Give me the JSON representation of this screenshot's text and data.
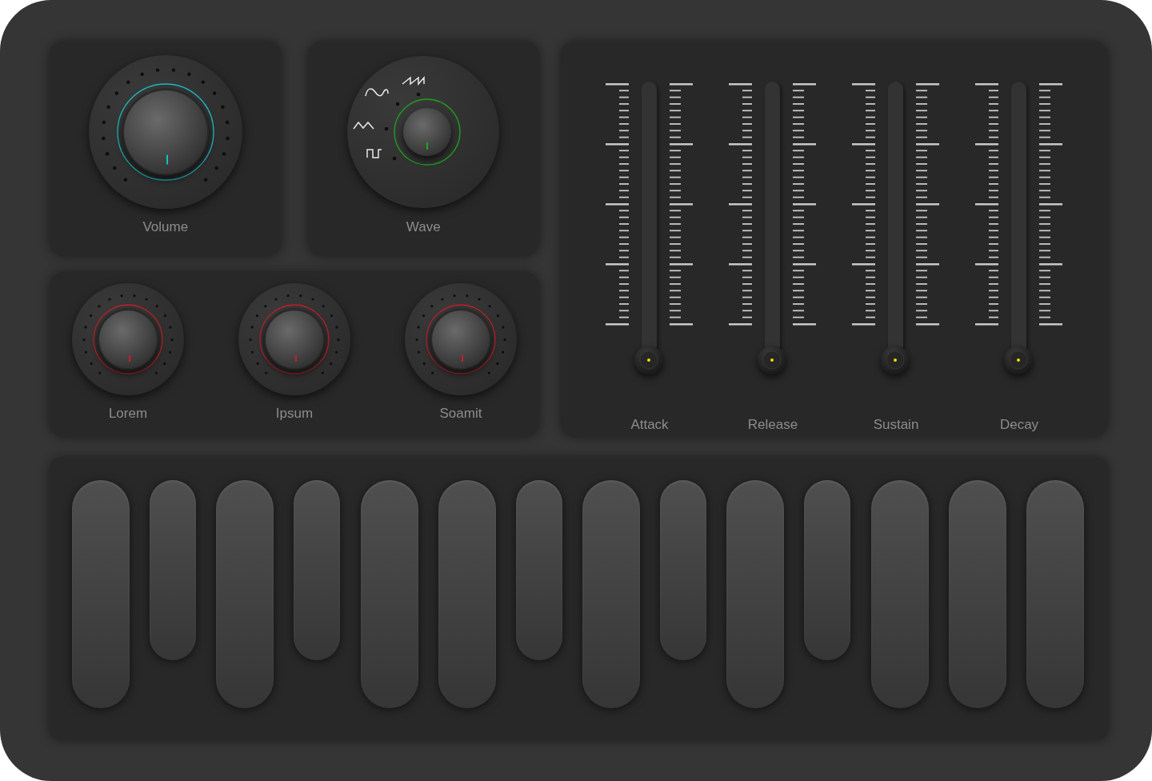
{
  "top_panels": [
    {
      "label": "Volume",
      "kind": "dial",
      "color": "#1fb8bd"
    },
    {
      "label": "Wave",
      "kind": "selector",
      "color": "#1ea51e"
    }
  ],
  "knobs": [
    {
      "label": "Lorem",
      "color": "#c3202b"
    },
    {
      "label": "Ipsum",
      "color": "#c3202b"
    },
    {
      "label": "Soamit",
      "color": "#c3202b"
    }
  ],
  "envelope": [
    {
      "label": "Attack",
      "level": 0
    },
    {
      "label": "Release",
      "level": 0
    },
    {
      "label": "Sustain",
      "level": 0
    },
    {
      "label": "Decay",
      "level": 0
    }
  ],
  "keys": [
    {
      "kind": "long"
    },
    {
      "kind": "short"
    },
    {
      "kind": "long"
    },
    {
      "kind": "short"
    },
    {
      "kind": "long"
    },
    {
      "kind": "long"
    },
    {
      "kind": "short"
    },
    {
      "kind": "long"
    },
    {
      "kind": "short"
    },
    {
      "kind": "long"
    },
    {
      "kind": "short"
    },
    {
      "kind": "long"
    },
    {
      "kind": "long"
    },
    {
      "kind": "long"
    }
  ]
}
